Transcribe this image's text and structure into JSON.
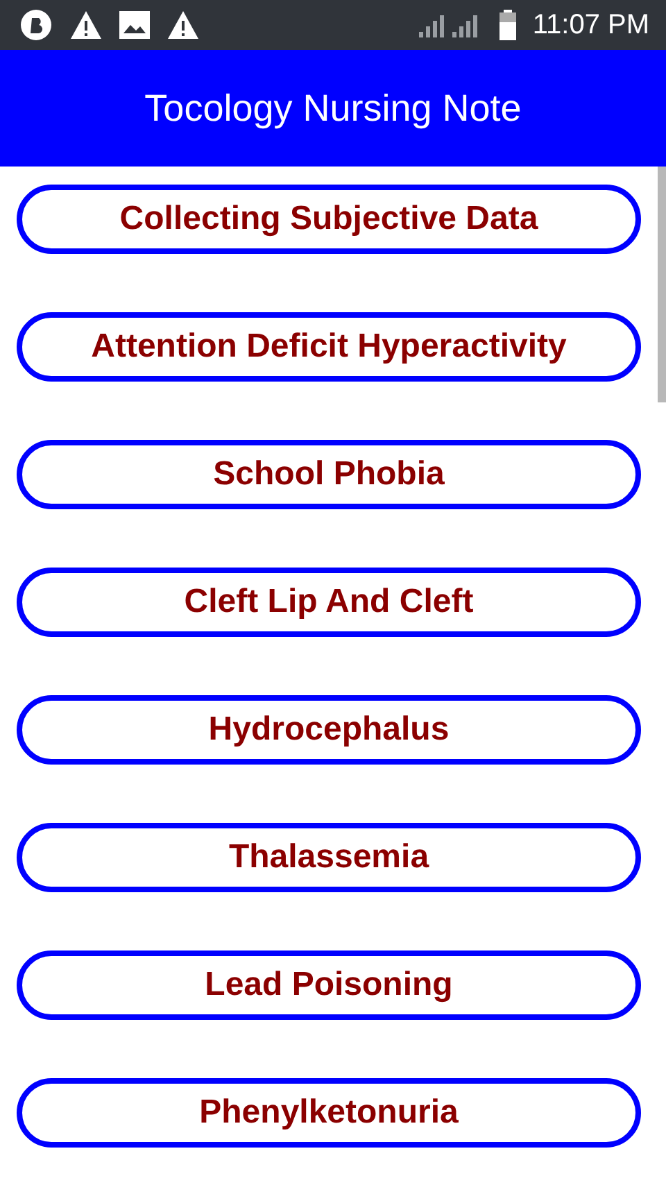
{
  "status_bar": {
    "time": "11:07 PM"
  },
  "app_bar": {
    "title": "Tocology Nursing Note"
  },
  "topics": [
    {
      "label": "Collecting Subjective Data"
    },
    {
      "label": "Attention Deficit Hyperactivity"
    },
    {
      "label": "School Phobia"
    },
    {
      "label": "Cleft Lip And Cleft"
    },
    {
      "label": "Hydrocephalus"
    },
    {
      "label": "Thalassemia"
    },
    {
      "label": "Lead Poisoning"
    },
    {
      "label": "Phenylketonuria"
    }
  ]
}
